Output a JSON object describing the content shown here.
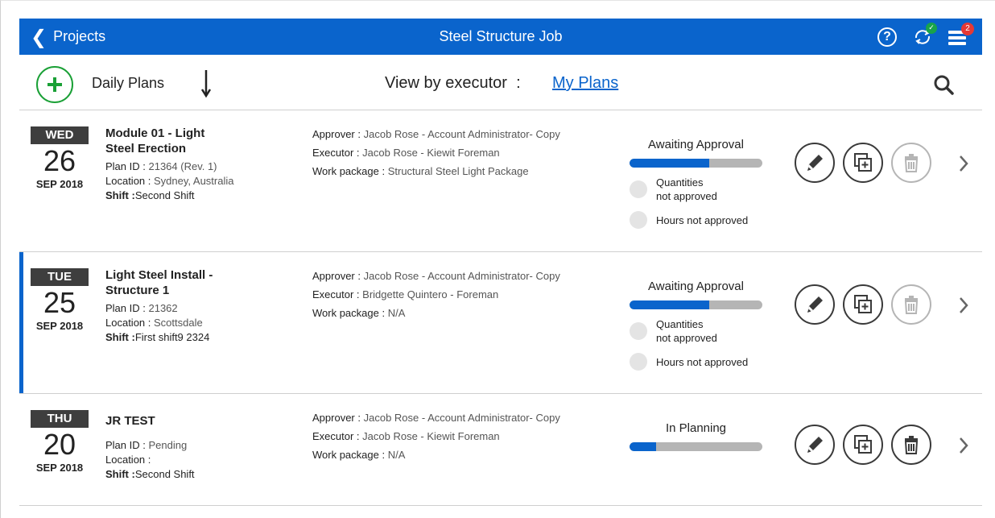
{
  "header": {
    "back_label": "Projects",
    "title": "Steel Structure Job",
    "menu_badge": "2"
  },
  "toolbar": {
    "daily_plans_label": "Daily Plans",
    "view_by_label": "View by executor",
    "view_by_separator": ":",
    "view_by_value": "My Plans"
  },
  "plans": [
    {
      "dow": "WED",
      "day": "26",
      "month": "SEP 2018",
      "title_line1": "Module 01 - Light",
      "title_line2": "Steel Erection",
      "plan_id_label": "Plan ID :",
      "plan_id": "21364 (Rev. 1)",
      "location_label": "Location :",
      "location": "Sydney, Australia",
      "shift_label": "Shift :",
      "shift": "Second Shift",
      "approver_label": "Approver :",
      "approver": "Jacob Rose - Account Administrator- Copy",
      "executor_label": "Executor :",
      "executor": "Jacob Rose - Kiewit Foreman",
      "work_package_label": "Work package :",
      "work_package": "Structural Steel Light Package",
      "status": "Awaiting Approval",
      "progress_pct": 60,
      "check1_line1": "Quantities",
      "check1_line2": "not approved",
      "check2": "Hours not approved",
      "delete_enabled": false,
      "selected": false
    },
    {
      "dow": "TUE",
      "day": "25",
      "month": "SEP 2018",
      "title_line1": "Light Steel Install -",
      "title_line2": "Structure 1",
      "plan_id_label": "Plan ID :",
      "plan_id": "21362",
      "location_label": "Location :",
      "location": "Scottsdale",
      "shift_label": "Shift :",
      "shift": "First shift9 2324",
      "approver_label": "Approver :",
      "approver": "Jacob Rose - Account Administrator- Copy",
      "executor_label": "Executor :",
      "executor": "Bridgette Quintero - Foreman",
      "work_package_label": "Work package :",
      "work_package": "N/A",
      "status": "Awaiting Approval",
      "progress_pct": 60,
      "check1_line1": "Quantities",
      "check1_line2": "not approved",
      "check2": "Hours not approved",
      "delete_enabled": false,
      "selected": true
    },
    {
      "dow": "THU",
      "day": "20",
      "month": "SEP 2018",
      "title_line1": "JR TEST",
      "title_line2": "",
      "plan_id_label": "Plan ID :",
      "plan_id": "Pending",
      "location_label": "Location :",
      "location": "",
      "shift_label": "Shift :",
      "shift": "Second Shift",
      "approver_label": "Approver :",
      "approver": "Jacob Rose - Account Administrator- Copy",
      "executor_label": "Executor :",
      "executor": "Jacob Rose - Kiewit Foreman",
      "work_package_label": "Work package :",
      "work_package": "N/A",
      "status": "In Planning",
      "progress_pct": 20,
      "delete_enabled": true,
      "selected": false
    }
  ],
  "icons": {
    "back": "chevron-left-icon",
    "help": "help-icon",
    "sync": "sync-icon",
    "menu": "menu-icon",
    "add": "plus-icon",
    "sort": "arrow-down-icon",
    "search": "search-icon",
    "edit": "pencil-icon",
    "copy": "copy-icon",
    "delete": "trash-icon",
    "open": "chevron-right-icon"
  },
  "colors": {
    "brand_blue": "#0a64cc",
    "add_green": "#1aa036",
    "badge_red": "#e53935",
    "sync_green": "#19a34a"
  }
}
